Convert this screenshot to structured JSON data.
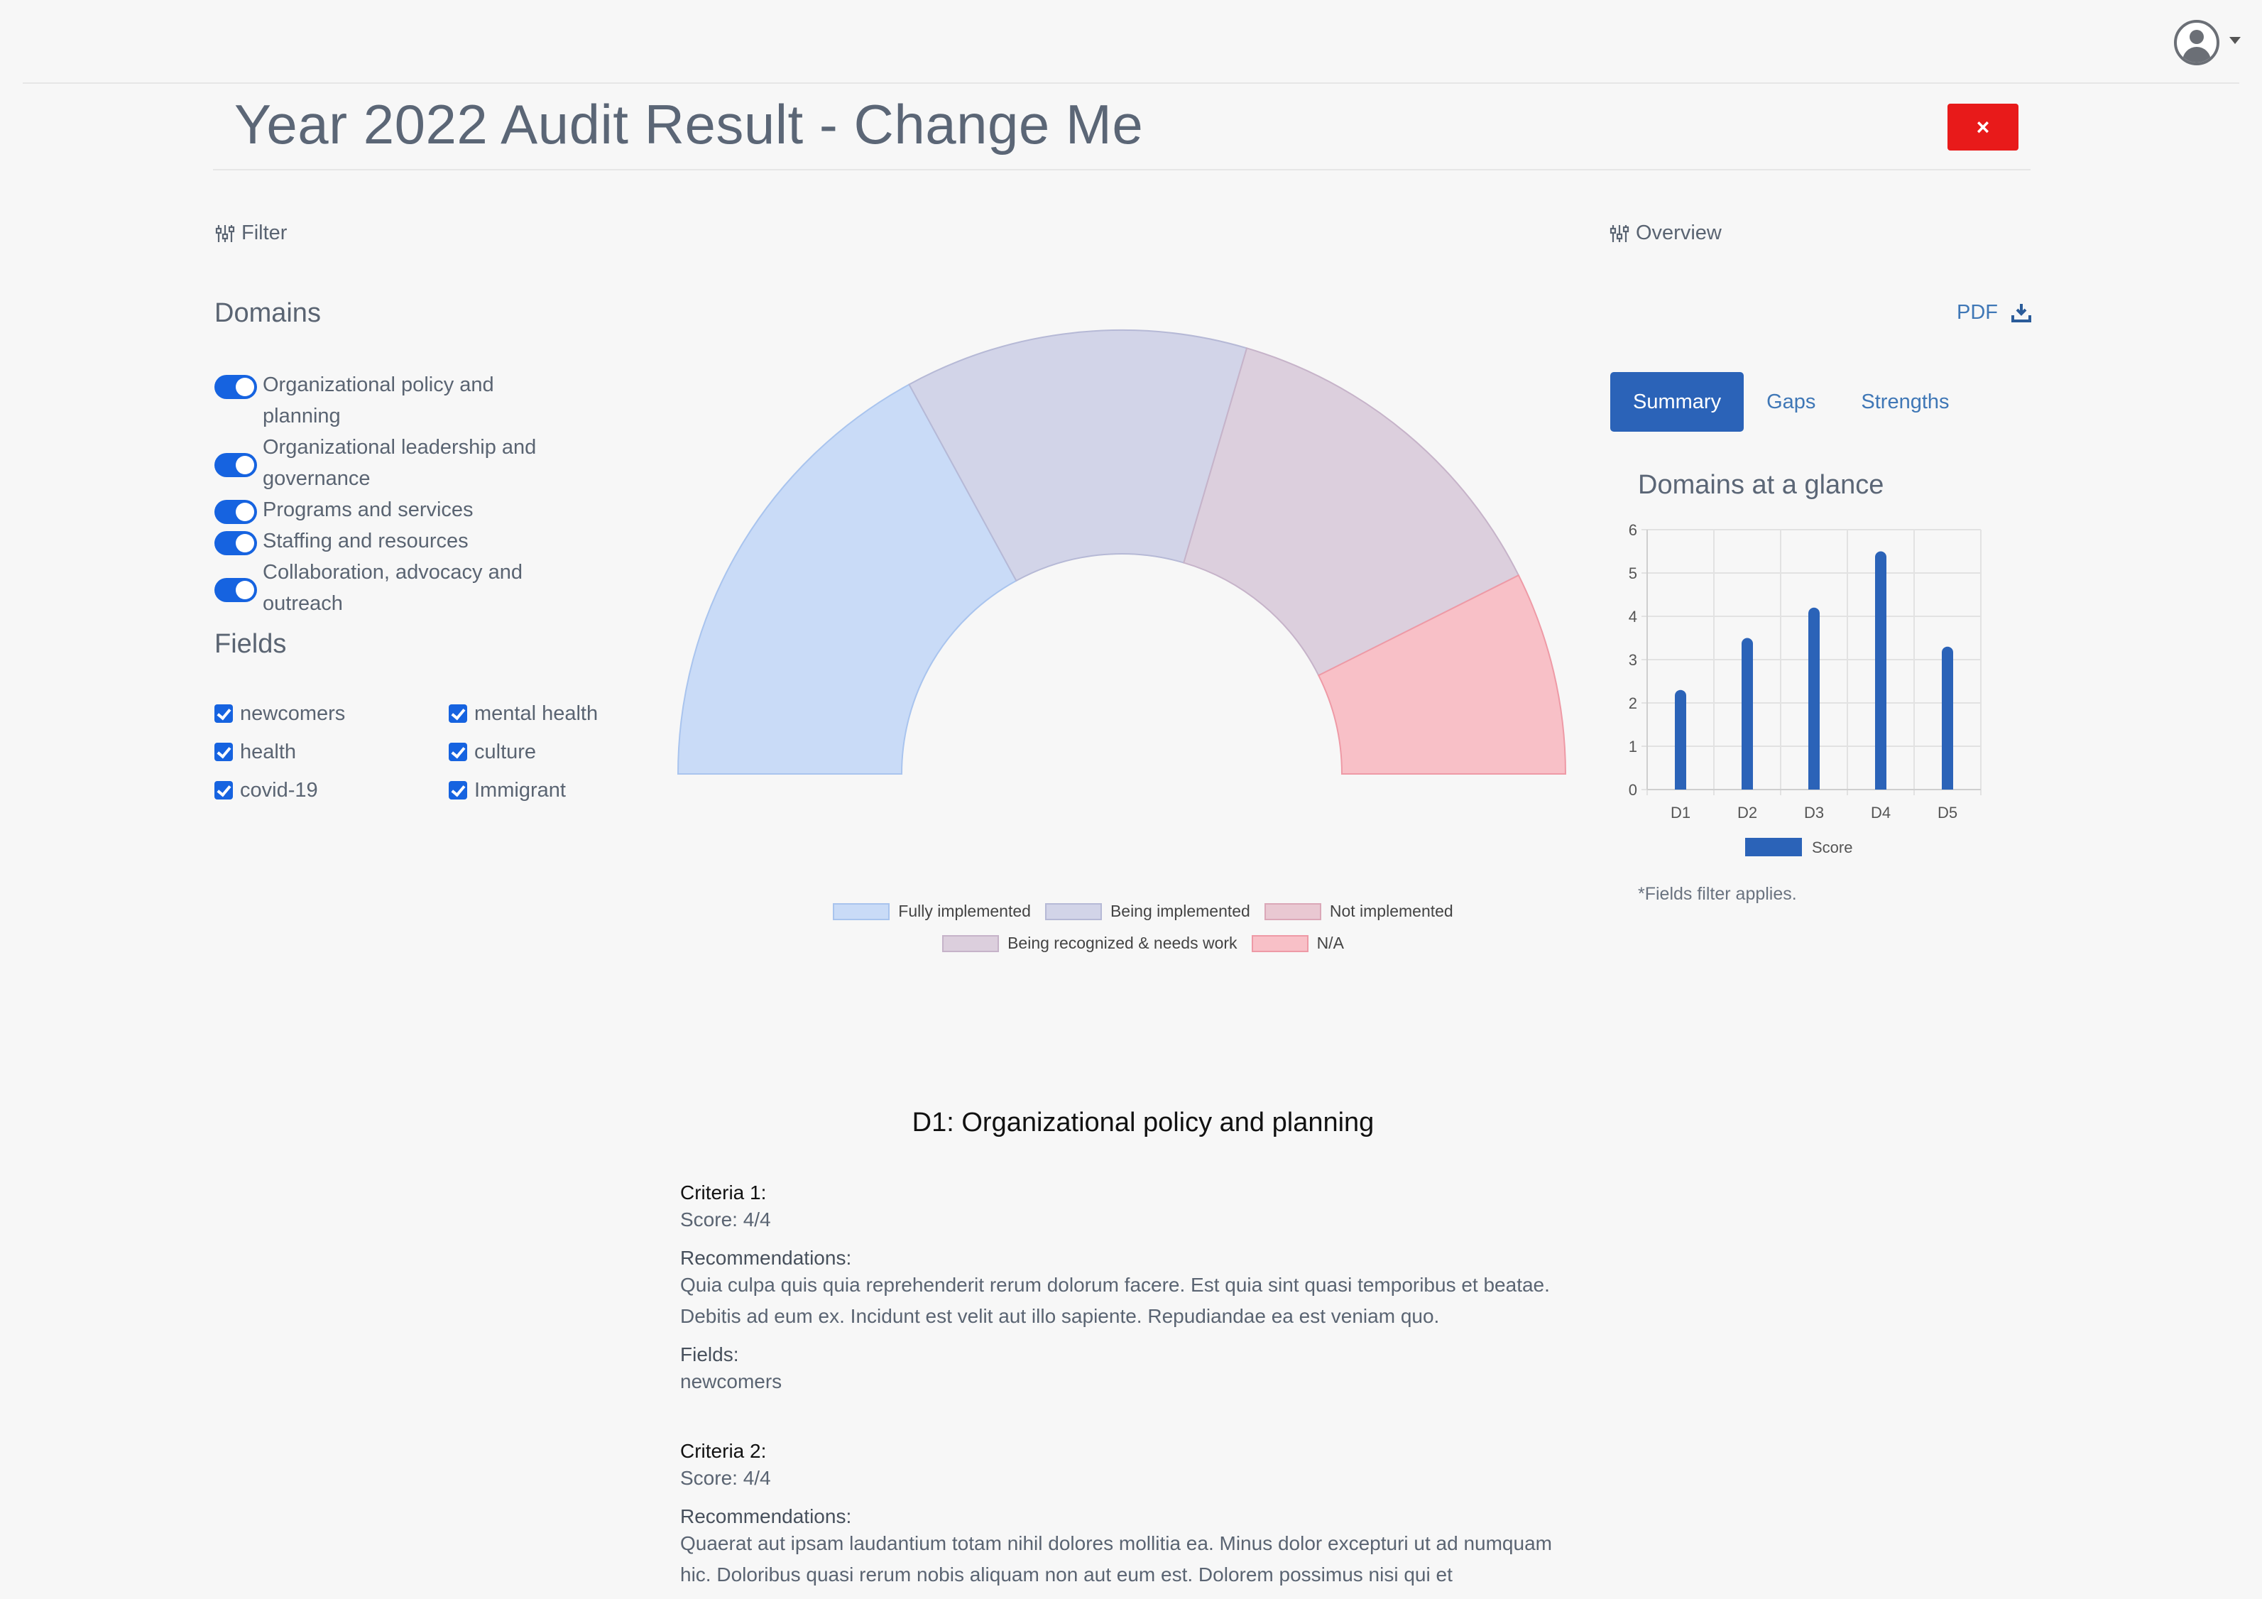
{
  "header": {
    "avatar_icon": "user-circle-icon"
  },
  "page": {
    "title": "Year 2022 Audit Result - Change Me",
    "close_label": "×"
  },
  "filter": {
    "heading": "Filter",
    "domains_heading": "Domains",
    "domains": [
      "Organizational policy and planning",
      "Organizational leadership and governance",
      "Programs and services",
      "Staffing and resources",
      "Collaboration, advocacy and outreach"
    ],
    "fields_heading": "Fields",
    "fields": [
      "newcomers",
      "mental health",
      "health",
      "culture",
      "covid-19",
      "Immigrant"
    ]
  },
  "gauge": {
    "legend": [
      {
        "label": "Fully implemented",
        "fill": "#c9dbf7",
        "stroke": "#a9c4ee"
      },
      {
        "label": "Being implemented",
        "fill": "#d2d4e8",
        "stroke": "#b6b9d6"
      },
      {
        "label": "Not implemented",
        "fill": "#e9c8d2",
        "stroke": "#dba8b8"
      },
      {
        "label": "Being recognized & needs work",
        "fill": "#dccfdd",
        "stroke": "#c6b3c9"
      },
      {
        "label": "N/A",
        "fill": "#f8c0c7",
        "stroke": "#ee9aa6"
      }
    ],
    "segments": [
      {
        "label": "Fully implemented",
        "value": 30
      },
      {
        "label": "Being implemented",
        "value": 22
      },
      {
        "label": "Being recognized & needs work",
        "value": 23
      },
      {
        "label": "N/A",
        "value": 13
      }
    ]
  },
  "overview": {
    "heading": "Overview",
    "pdf_label": "PDF",
    "tabs": [
      "Summary",
      "Gaps",
      "Strengths"
    ],
    "chart_title": "Domains at a glance",
    "note": "*Fields filter applies."
  },
  "chart_data": {
    "type": "bar",
    "title": "Domains at a glance",
    "categories": [
      "D1",
      "D2",
      "D3",
      "D4",
      "D5"
    ],
    "series": [
      {
        "name": "Score",
        "values": [
          2.3,
          3.5,
          4.2,
          5.5,
          3.3
        ],
        "color": "#2b63b8"
      }
    ],
    "ylim": [
      0,
      6
    ],
    "yticks": [
      0,
      1,
      2,
      3,
      4,
      5,
      6
    ],
    "grid": true,
    "legend": "bottom"
  },
  "detail": {
    "domain_title": "D1: Organizational policy and planning",
    "criteria": [
      {
        "label": "Criteria 1:",
        "score": "Score: 4/4",
        "rec_label": "Recommendations:",
        "rec_text": "Quia culpa quis quia reprehenderit rerum dolorum facere. Est quia sint quasi temporibus et beatae. Debitis ad eum ex. Incidunt est velit aut illo sapiente. Repudiandae ea est veniam quo.",
        "fields_label": "Fields:",
        "fields_value": "newcomers"
      },
      {
        "label": "Criteria 2:",
        "score": "Score: 4/4",
        "rec_label": "Recommendations:",
        "rec_text": "Quaerat aut ipsam laudantium totam nihil dolores mollitia ea. Minus dolor excepturi ut ad numquam hic. Doloribus quasi rerum nobis aliquam non aut eum est. Dolorem possimus nisi qui et"
      }
    ]
  }
}
